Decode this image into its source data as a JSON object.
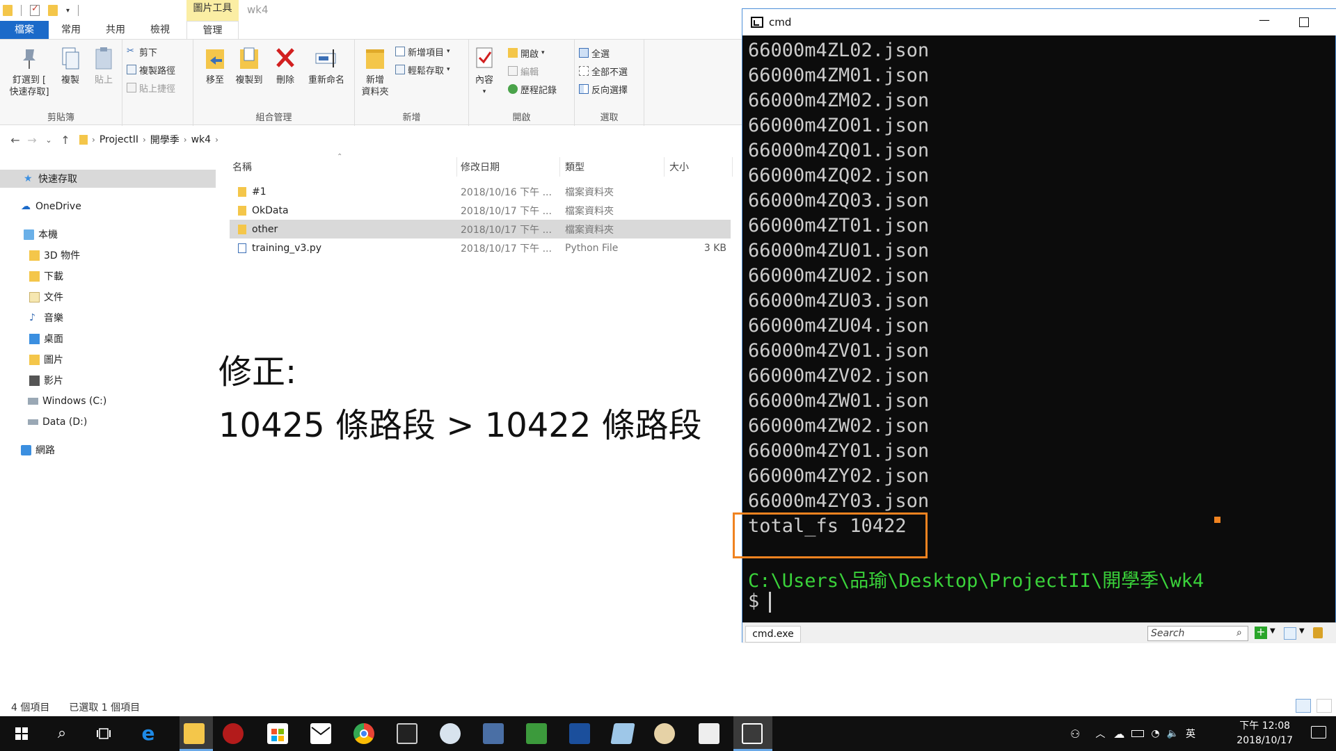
{
  "explorer": {
    "context_tab": "圖片工具",
    "window_title": "wk4",
    "tabs": {
      "file": "檔案",
      "home": "常用",
      "share": "共用",
      "view": "檢視",
      "manage": "管理"
    },
    "ribbon": {
      "clipboard": {
        "label": "剪貼簿",
        "pin_line1": "釘選到 [",
        "pin_line2": "快速存取]",
        "copy": "複製",
        "paste": "貼上",
        "cut": "剪下",
        "copy_path": "複製路徑",
        "paste_shortcut": "貼上捷徑"
      },
      "organize": {
        "label": "組合管理",
        "move_to": "移至",
        "copy_to": "複製到",
        "delete": "刪除",
        "rename": "重新命名"
      },
      "new": {
        "label": "新增",
        "new_folder_line1": "新增",
        "new_folder_line2": "資料夾",
        "new_item": "新增項目",
        "easy_access": "輕鬆存取"
      },
      "open": {
        "label": "開啟",
        "properties": "內容",
        "open": "開啟",
        "edit": "編輯",
        "history": "歷程記錄"
      },
      "select": {
        "label": "選取",
        "select_all": "全選",
        "select_none": "全部不選",
        "invert": "反向選擇"
      }
    },
    "breadcrumb": [
      "ProjectII",
      "開學季",
      "wk4"
    ],
    "nav": {
      "quick_access": "快速存取",
      "onedrive": "OneDrive",
      "this_pc": "本機",
      "objects3d": "3D 物件",
      "downloads": "下載",
      "documents": "文件",
      "music": "音樂",
      "desktop": "桌面",
      "pictures": "圖片",
      "videos": "影片",
      "drive_c": "Windows (C:)",
      "drive_d": "Data (D:)",
      "network": "網路"
    },
    "columns": {
      "name": "名稱",
      "modified": "修改日期",
      "type": "類型",
      "size": "大小"
    },
    "files": [
      {
        "name": "#1",
        "date": "2018/10/16 下午 ...",
        "type": "檔案資料夾",
        "size": ""
      },
      {
        "name": "OkData",
        "date": "2018/10/17 下午 ...",
        "type": "檔案資料夾",
        "size": ""
      },
      {
        "name": "other",
        "date": "2018/10/17 下午 ...",
        "type": "檔案資料夾",
        "size": ""
      },
      {
        "name": "training_v3.py",
        "date": "2018/10/17 下午 ...",
        "type": "Python File",
        "size": "3 KB"
      }
    ],
    "note_line1": "修正:",
    "note_line2": "10425 條路段 > 10422 條路段",
    "status_count": "4 個項目",
    "status_selected": "已選取 1 個項目"
  },
  "cmd": {
    "title": "cmd",
    "lines": [
      "66000m4ZL02.json",
      "66000m4ZM01.json",
      "66000m4ZM02.json",
      "66000m4ZO01.json",
      "66000m4ZQ01.json",
      "66000m4ZQ02.json",
      "66000m4ZQ03.json",
      "66000m4ZT01.json",
      "66000m4ZU01.json",
      "66000m4ZU02.json",
      "66000m4ZU03.json",
      "66000m4ZU04.json",
      "66000m4ZV01.json",
      "66000m4ZV02.json",
      "66000m4ZW01.json",
      "66000m4ZW02.json",
      "66000m4ZY01.json",
      "66000m4ZY02.json",
      "66000m4ZY03.json"
    ],
    "total": "total_fs 10422",
    "path": "C:\\Users\\品瑜\\Desktop\\ProjectII\\開學季\\wk4",
    "prompt": "$",
    "tab_label": "cmd.exe",
    "search_placeholder": "Search"
  },
  "taskbar": {
    "clock_time": "下午 12:08",
    "clock_date": "2018/10/17",
    "ime": "英"
  },
  "colors": {
    "accent": "#1b6ac9",
    "highlight_box": "#f08320",
    "terminal_green": "#3ad23a",
    "terminal_bg": "#0c0c0c"
  }
}
